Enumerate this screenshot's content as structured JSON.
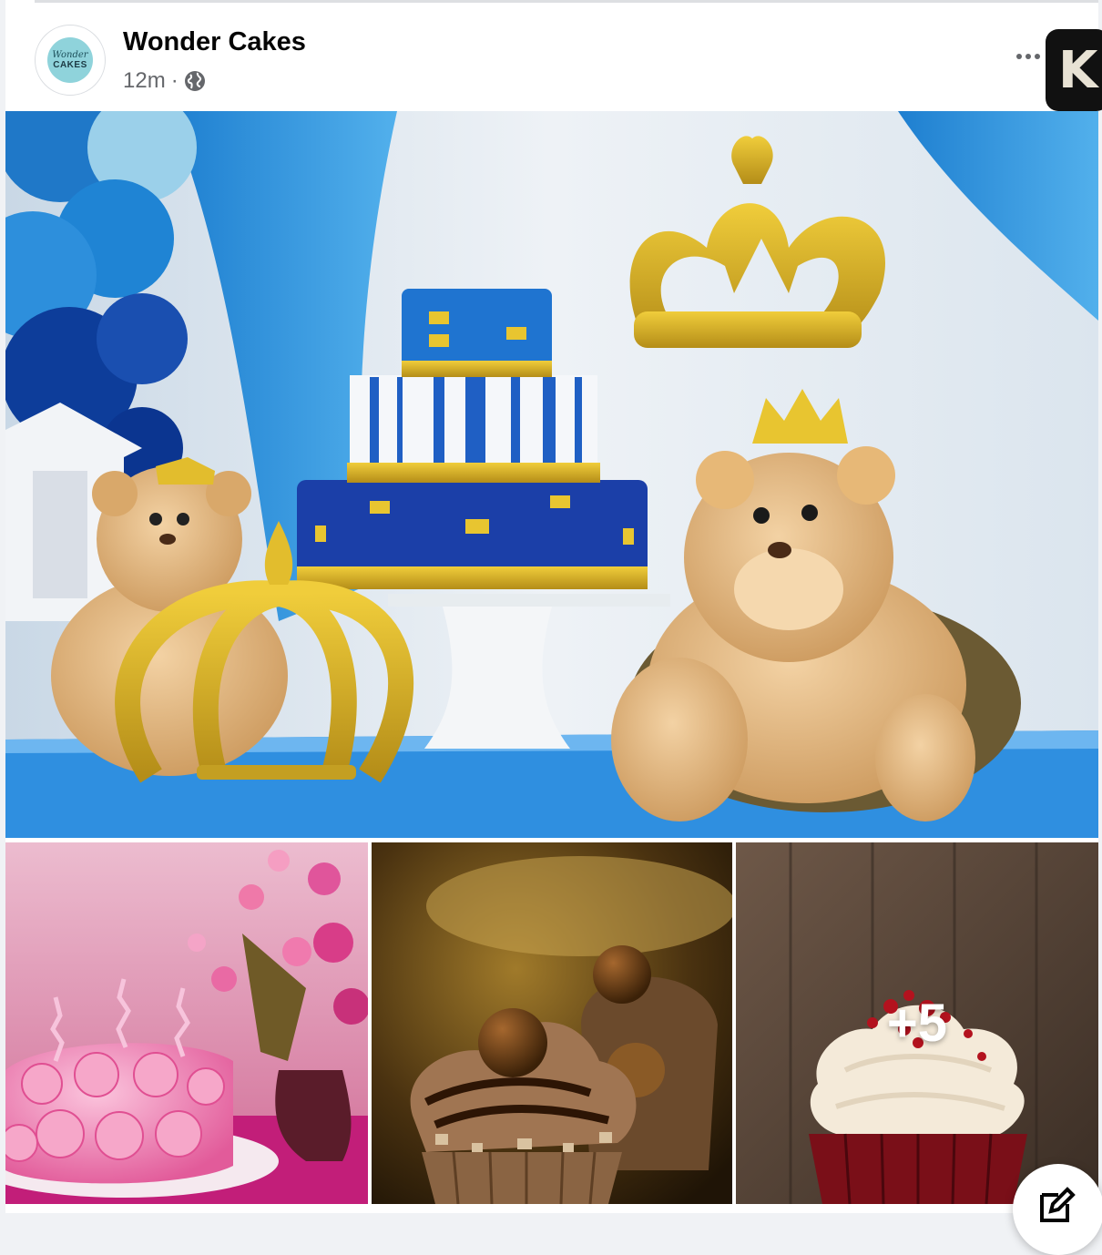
{
  "post": {
    "page_name": "Wonder Cakes",
    "time": "12m",
    "separator": "·",
    "audience_icon": "globe-icon",
    "more_icon": "more-options-icon"
  },
  "avatar": {
    "line1": "Wonder",
    "line2": "CAKES"
  },
  "extension_badge": {
    "letter": "K"
  },
  "photos": {
    "more_count": "+5",
    "items": [
      {
        "subject": "royal-blue-cake-with-teddy-bears"
      },
      {
        "subject": "pink-rose-cake-with-candles"
      },
      {
        "subject": "chocolate-hazelnut-cupcake"
      },
      {
        "subject": "red-velvet-cupcake"
      }
    ]
  },
  "colors": {
    "primary_text": "#050505",
    "secondary_text": "#65676b",
    "avatar_bg": "#8fd3db"
  },
  "compose_icon": "compose-icon"
}
